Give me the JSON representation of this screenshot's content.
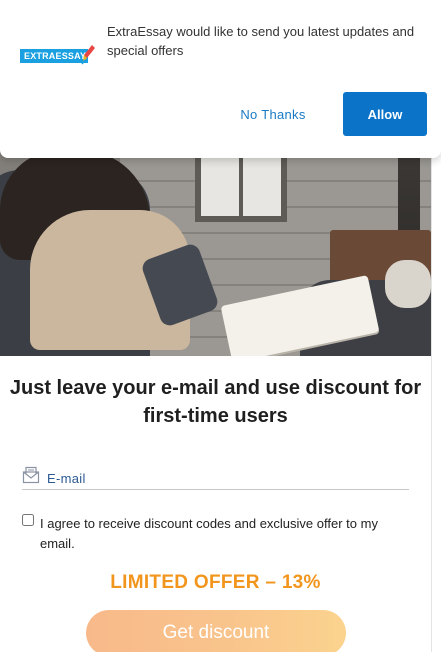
{
  "notification": {
    "logo_text": "EXTRAESSAY",
    "message": "ExtraEssay would like to send you latest updates and special offers",
    "no_thanks_label": "No Thanks",
    "allow_label": "Allow"
  },
  "form": {
    "headline": "Just leave your e-mail and use discount for first-time users",
    "email_placeholder": "E-mail",
    "consent_label": "I agree to receive discount codes and exclusive offer to my email.",
    "consent_checked": false,
    "offer_text": "LIMITED OFFER – 13%",
    "submit_label": "Get discount"
  },
  "colors": {
    "allow_button": "#0b74c9",
    "offer_accent": "#f2951c",
    "submit_gradient_start": "#f8b98a",
    "submit_gradient_end": "#fbd38e"
  },
  "icons": [
    "logo-icon",
    "rocket-icon",
    "mail-icon"
  ]
}
